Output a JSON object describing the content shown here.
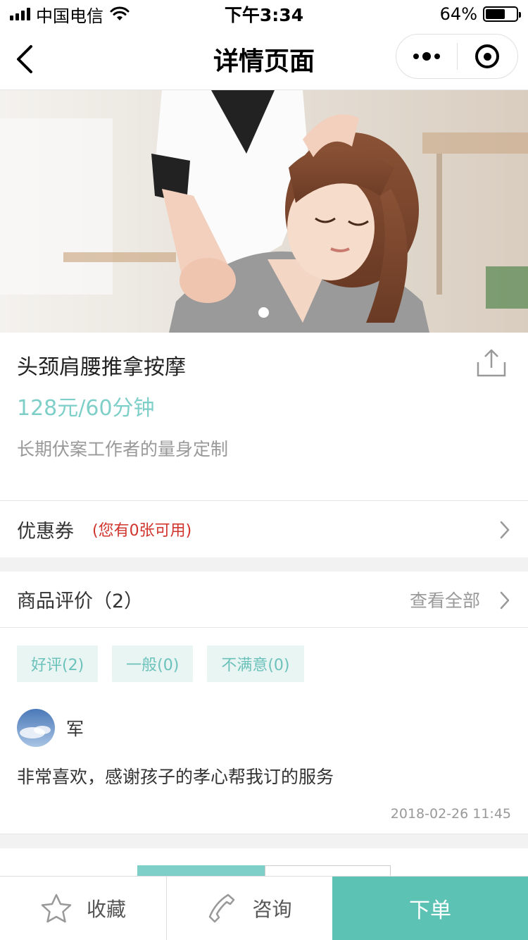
{
  "status_bar": {
    "carrier": "中国电信",
    "time": "下午3:34",
    "battery": "64%",
    "battery_level": 0.64
  },
  "nav": {
    "title": "详情页面",
    "back_icon": "chevron-left-icon",
    "more_icon": "more-dots-icon",
    "close_icon": "target-close-icon"
  },
  "banner": {
    "slides": 1,
    "active_slide": 0
  },
  "product": {
    "title": "头颈肩腰推拿按摩",
    "price": "128元/60分钟",
    "description": "长期伏案工作者的量身定制",
    "share_icon": "share-icon"
  },
  "coupon": {
    "label": "优惠券",
    "note": "(您有0张可用)"
  },
  "reviews": {
    "label": "商品评价（2）",
    "view_all": "查看全部",
    "filters": [
      "好评(2)",
      "一般(0)",
      "不满意(0)"
    ],
    "items": [
      {
        "name": "军",
        "text": "非常喜欢，感谢孩子的孝心帮我订的服务",
        "time": "2018-02-26 11:45"
      }
    ]
  },
  "bottom_bar": {
    "favorite": "收藏",
    "consult": "咨询",
    "order": "下单"
  },
  "colors": {
    "accent": "#5cc2b4",
    "price": "#7fcfc9",
    "chip_bg": "#e8f5f3",
    "coupon_note": "#d0342c"
  }
}
